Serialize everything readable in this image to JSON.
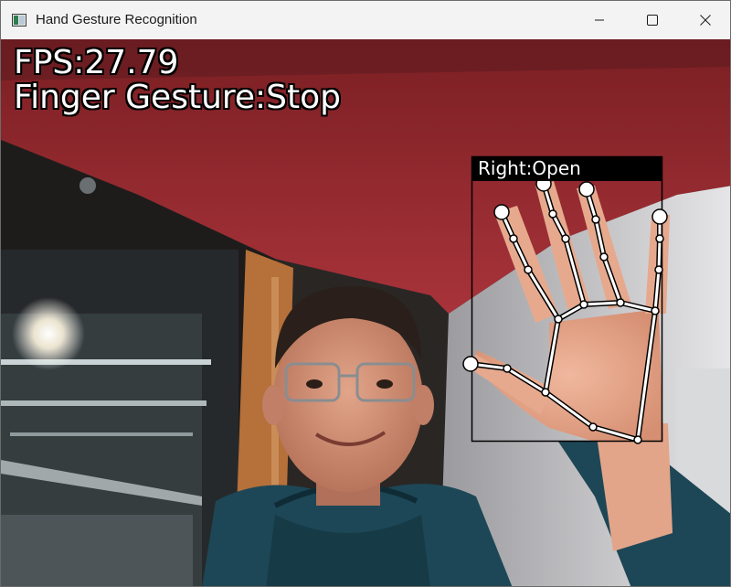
{
  "window": {
    "title": "Hand Gesture Recognition",
    "app_icon": "camera-app-icon",
    "controls": [
      "minimize-icon",
      "maximize-icon",
      "close-icon"
    ]
  },
  "overlay": {
    "fps_text": "FPS:27.79",
    "finger_gesture_text": "Finger Gesture:Stop",
    "hand_label": "Right:Open"
  },
  "colors": {
    "titlebar": "#f3f3f3",
    "overlay_text": "#ffffff",
    "outline": "#000000",
    "landmark": "#ffffff"
  }
}
